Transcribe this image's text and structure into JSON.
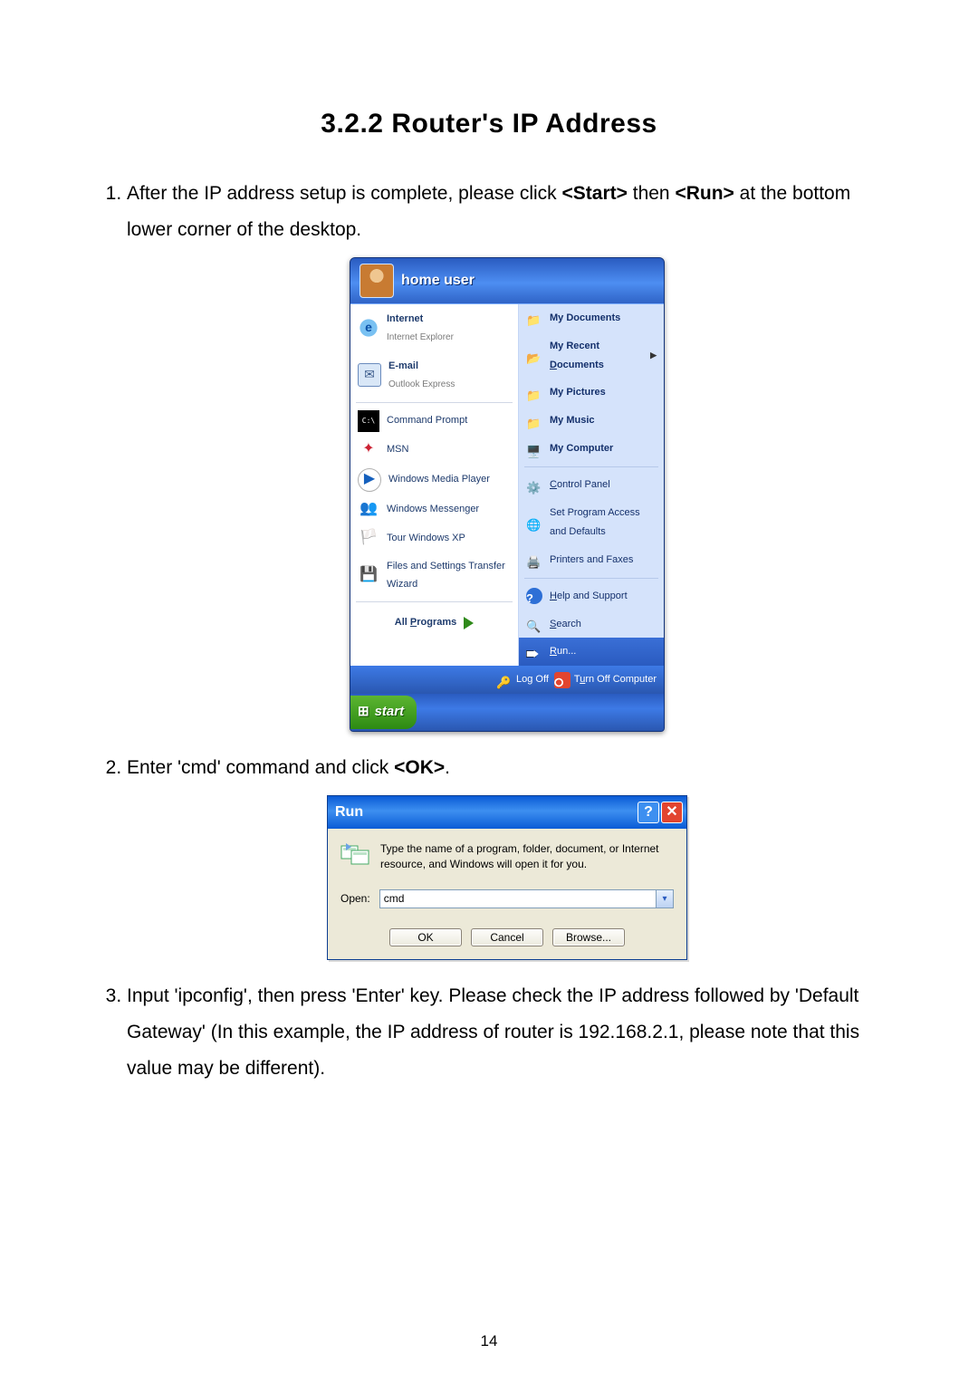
{
  "section_title": "3.2.2  Router's IP Address",
  "steps": {
    "s1_pre": "After the IP address setup is complete, please click ",
    "s1_b1": "<Start>",
    "s1_mid": " then ",
    "s1_b2": "<Run>",
    "s1_post": " at the bottom lower corner of the desktop.",
    "s2_pre": "Enter 'cmd' command and click ",
    "s2_b": "<OK>",
    "s2_post": ".",
    "s3": "Input 'ipconfig', then press 'Enter' key. Please check the IP address followed by 'Default Gateway' (In this example, the IP address of router is 192.168.2.1, please note that this value may be different)."
  },
  "startmenu": {
    "user": "home user",
    "left_pinned": [
      {
        "title": "Internet",
        "sub": "Internet Explorer"
      },
      {
        "title": "E-mail",
        "sub": "Outlook Express"
      }
    ],
    "left_recent": [
      "Command Prompt",
      "MSN",
      "Windows Media Player",
      "Windows Messenger",
      "Tour Windows XP",
      "Files and Settings Transfer Wizard"
    ],
    "all_programs": "All Programs",
    "right_top": [
      "My Documents",
      "My Recent Documents",
      "My Pictures",
      "My Music",
      "My Computer"
    ],
    "right_mid": [
      "Control Panel",
      "Set Program Access and Defaults",
      "Printers and Faxes"
    ],
    "right_bottom": [
      "Help and Support",
      "Search",
      "Run..."
    ],
    "logoff": "Log Off",
    "turnoff": "Turn Off Computer",
    "start": "start"
  },
  "run": {
    "title": "Run",
    "desc": "Type the name of a program, folder, document, or Internet resource, and Windows will open it for you.",
    "open_label": "Open:",
    "value": "cmd",
    "ok": "OK",
    "cancel": "Cancel",
    "browse": "Browse..."
  },
  "page_number": "14"
}
